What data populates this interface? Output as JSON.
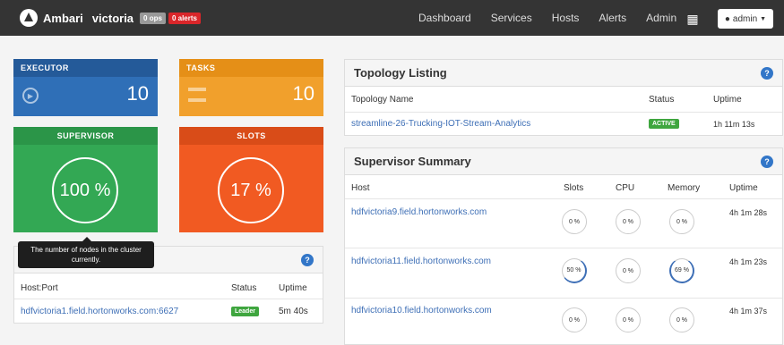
{
  "navbar": {
    "brand": "Ambari",
    "cluster": "victoria",
    "ops_badge": "0 ops",
    "alerts_badge": "0 alerts",
    "links": [
      "Dashboard",
      "Services",
      "Hosts",
      "Alerts",
      "Admin"
    ],
    "user_button": "admin",
    "grid_icon": "grid-icon"
  },
  "tiles": {
    "executor": {
      "label": "EXECUTOR",
      "value": "10",
      "color": "#2f6fb7"
    },
    "tasks": {
      "label": "TASKS",
      "value": "10",
      "color": "#f1a02c"
    },
    "supervisor": {
      "label": "SUPERVISOR",
      "value": "100 %",
      "color": "#33a854"
    },
    "slots": {
      "label": "SLOTS",
      "value": "17 %",
      "color": "#f15a22"
    }
  },
  "tooltip": "The number of nodes in the cluster currently.",
  "nimbus": {
    "col_host": "Host:Port",
    "col_status": "Status",
    "col_uptime": "Uptime",
    "row": {
      "host": "hdfvictoria1.field.hortonworks.com:6627",
      "status": "Leader",
      "uptime": "5m 40s"
    }
  },
  "topology": {
    "title": "Topology Listing",
    "col_name": "Topology Name",
    "col_status": "Status",
    "col_uptime": "Uptime",
    "row": {
      "name": "streamline-26-Trucking-IOT-Stream-Analytics",
      "status": "ACTIVE",
      "uptime": "1h 11m 13s"
    }
  },
  "supervisor_summary": {
    "title": "Supervisor Summary",
    "columns": [
      "Host",
      "Slots",
      "CPU",
      "Memory",
      "Uptime"
    ],
    "rows": [
      {
        "host": "hdfvictoria9.field.hortonworks.com",
        "slots": "0 %",
        "cpu": "0 %",
        "memory": "0 %",
        "uptime": "4h 1m 28s"
      },
      {
        "host": "hdfvictoria11.field.hortonworks.com",
        "slots": "50 %",
        "cpu": "0 %",
        "memory": "69 %",
        "uptime": "4h 1m 23s"
      },
      {
        "host": "hdfvictoria10.field.hortonworks.com",
        "slots": "0 %",
        "cpu": "0 %",
        "memory": "0 %",
        "uptime": "4h 1m 37s"
      }
    ]
  }
}
